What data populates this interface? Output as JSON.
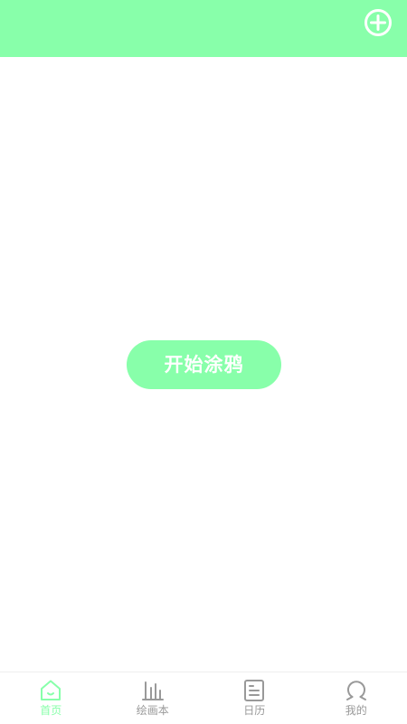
{
  "colors": {
    "accent": "#88ffaa",
    "inactive": "#999999",
    "background": "#ffffff"
  },
  "header": {
    "add_icon": "plus-circle-icon"
  },
  "main": {
    "start_button_label": "开始涂鸦"
  },
  "bottom_nav": {
    "items": [
      {
        "label": "首页",
        "icon": "home-icon",
        "active": true
      },
      {
        "label": "绘画本",
        "icon": "bar-chart-icon",
        "active": false
      },
      {
        "label": "日历",
        "icon": "document-icon",
        "active": false
      },
      {
        "label": "我的",
        "icon": "profile-icon",
        "active": false
      }
    ]
  }
}
